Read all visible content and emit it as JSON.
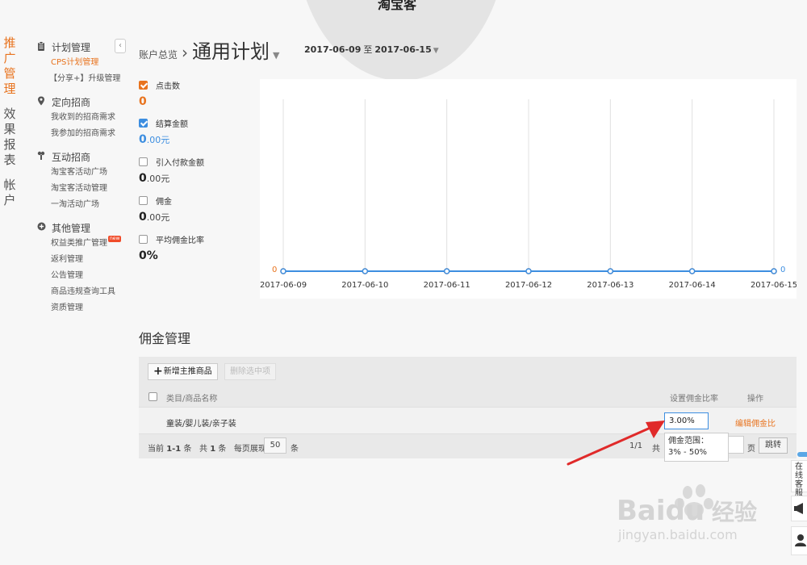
{
  "brand": {
    "title": "淘宝客"
  },
  "primary_nav": [
    {
      "label": "推广管理",
      "active": true
    },
    {
      "label": "效果报表",
      "active": false
    },
    {
      "label": "帐户",
      "active": false
    }
  ],
  "sub_nav": {
    "collapse_icon": "chevron-left-icon",
    "groups": [
      {
        "title": "计划管理",
        "icon": "clipboard-icon",
        "items": [
          {
            "label": "CPS计划管理",
            "active": true
          },
          {
            "label": "【分享+】升级管理",
            "active": false
          }
        ]
      },
      {
        "title": "定向招商",
        "icon": "location-pin-icon",
        "items": [
          {
            "label": "我收到的招商需求",
            "active": false
          },
          {
            "label": "我参加的招商需求",
            "active": false
          }
        ]
      },
      {
        "title": "互动招商",
        "icon": "handshake-icon",
        "items": [
          {
            "label": "淘宝客活动广场",
            "active": false
          },
          {
            "label": "淘宝客活动管理",
            "active": false
          },
          {
            "label": "一淘活动广场",
            "active": false
          }
        ]
      },
      {
        "title": "其他管理",
        "icon": "plus-circle-icon",
        "items": [
          {
            "label": "权益类推广管理",
            "badge": "new",
            "active": false
          },
          {
            "label": "返利管理",
            "active": false
          },
          {
            "label": "公告管理",
            "active": false
          },
          {
            "label": "商品违规查询工具",
            "active": false
          },
          {
            "label": "资质管理",
            "active": false
          }
        ]
      }
    ]
  },
  "breadcrumb": {
    "root": "账户总览",
    "separator": "›",
    "current": "通用计划"
  },
  "date_range": {
    "start": "2017-06-09",
    "to": "至",
    "end": "2017-06-15"
  },
  "metrics": [
    {
      "label": "点击数",
      "value": "0",
      "unit": "",
      "checked": true,
      "color": "#e8731e"
    },
    {
      "label": "结算金额",
      "value": "0",
      "unit": ".00元",
      "checked": true,
      "color": "#3d8ee0"
    },
    {
      "label": "引入付款金额",
      "value": "0",
      "unit": ".00元",
      "checked": false
    },
    {
      "label": "佣金",
      "value": "0",
      "unit": ".00元",
      "checked": false
    },
    {
      "label": "平均佣金比率",
      "value": "0%",
      "unit": "",
      "checked": false
    }
  ],
  "chart_data": {
    "type": "line",
    "x": [
      "2017-06-09",
      "2017-06-10",
      "2017-06-11",
      "2017-06-12",
      "2017-06-13",
      "2017-06-14",
      "2017-06-15"
    ],
    "series": [
      {
        "values": [
          0,
          0,
          0,
          0,
          0,
          0,
          0
        ],
        "color": "#e8731e"
      },
      {
        "values": [
          0,
          0,
          0,
          0,
          0,
          0,
          0
        ],
        "color": "#3d8ee0"
      }
    ],
    "y_left_label": "0",
    "y_right_label": "0",
    "grid": "vertical",
    "legend": "none"
  },
  "commission": {
    "title": "佣金管理",
    "add_button": "新增主推商品",
    "delete_button": "删除选中项",
    "columns": {
      "name": "类目/商品名称",
      "rate": "设置佣金比率",
      "op": "操作"
    },
    "rows": [
      {
        "name": "童装/婴儿装/亲子装",
        "rate": "3.00%",
        "op": "编辑佣金比"
      }
    ],
    "tooltip": {
      "line1": "佣金范围：",
      "line2": "3% - 50%"
    },
    "pager": {
      "current_label": "当前",
      "current_range": "1-1",
      "item_unit": "条",
      "total_label": "共",
      "total_count": "1",
      "total_unit": "条",
      "page_size_label": "每页展现",
      "page_size": "50",
      "page_size_unit": "条",
      "page_fraction": "1/1",
      "total_short": "共",
      "page_unit": "页",
      "jump": "跳转"
    }
  },
  "side_panel": {
    "text": "在线客服",
    "icons": [
      "megaphone-icon",
      "user-icon"
    ]
  },
  "watermark": {
    "brand": "Baidu",
    "cn": "经验",
    "url": "jingyan.baidu.com"
  }
}
